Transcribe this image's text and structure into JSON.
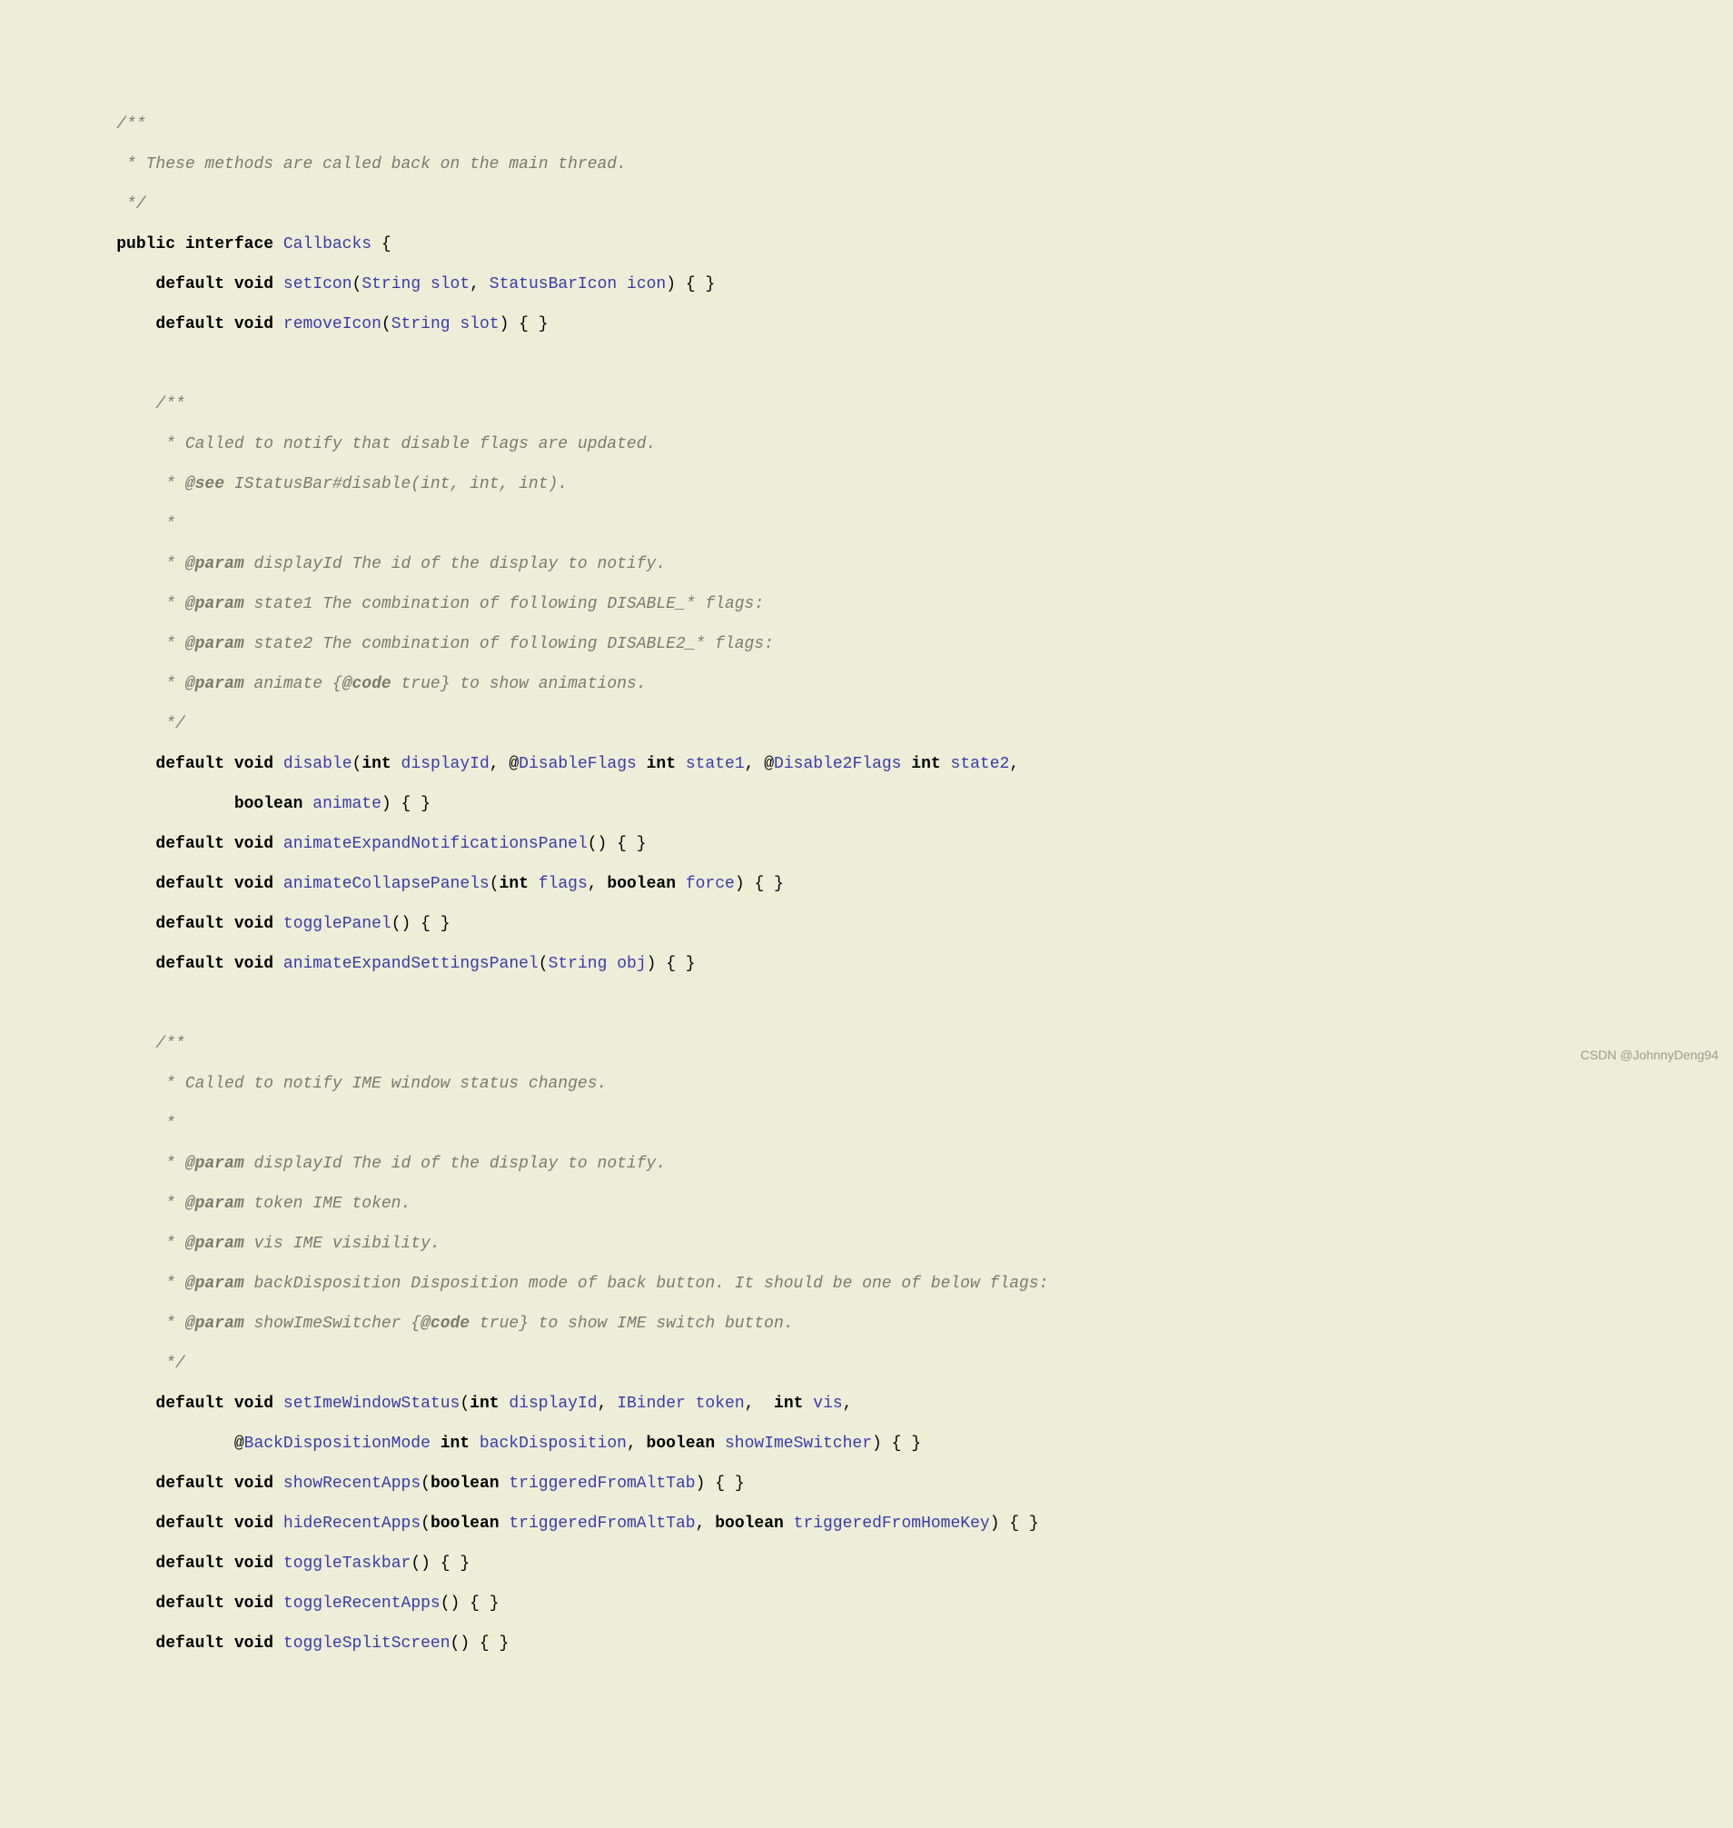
{
  "code": {
    "l1": "    /**",
    "l2_a": "     * ",
    "l2_b": "These methods are called back on the main thread.",
    "l3": "     */",
    "l4_kw1": "public",
    "l4_kw2": "interface",
    "l4_name": "Callbacks",
    "l4_open": " {",
    "l5_kw1": "default",
    "l5_kw2": "void",
    "l5_m": "setIcon",
    "l5_t1": "String",
    "l5_p1": "slot",
    "l5_t2": "StatusBarIcon",
    "l5_p2": "icon",
    "l5_end": ") { }",
    "l6_kw1": "default",
    "l6_kw2": "void",
    "l6_m": "removeIcon",
    "l6_t1": "String",
    "l6_p1": "slot",
    "l6_end": ") { }",
    "l8": "        /**",
    "l9_a": "         * ",
    "l9_b": "Called to notify that disable flags are updated.",
    "l10_a": "         * ",
    "l10_b": "@see",
    "l10_c": " IStatusBar#disable(int, int, int).",
    "l11": "         *",
    "l12_a": "         * ",
    "l12_b": "@param",
    "l12_c": "displayId",
    "l12_d": " The id of the display to notify.",
    "l13_a": "         * ",
    "l13_b": "@param",
    "l13_c": "state1",
    "l13_d": " The combination of following DISABLE_* flags:",
    "l14_a": "         * ",
    "l14_b": "@param",
    "l14_c": "state2",
    "l14_d": " The combination of following DISABLE2_* flags:",
    "l15_a": "         * ",
    "l15_b": "@param",
    "l15_c": "animate",
    "l15_d": " {",
    "l15_e": "@code",
    "l15_f": " true} to show animations.",
    "l16": "         */",
    "l17_kw1": "default",
    "l17_kw2": "void",
    "l17_m": "disable",
    "l17_kw3": "int",
    "l17_p1": "displayId",
    "l17_s1": ", @",
    "l17_t1": "DisableFlags",
    "l17_kw4": "int",
    "l17_p2": "state1",
    "l17_s2": ", @",
    "l17_t2": "Disable2Flags",
    "l17_kw5": "int",
    "l17_p3": "state2",
    "l17_end": ",",
    "l18_kw1": "boolean",
    "l18_p1": "animate",
    "l18_end": ") { }",
    "l19_kw1": "default",
    "l19_kw2": "void",
    "l19_m": "animateExpandNotificationsPanel",
    "l19_end": "() { }",
    "l20_kw1": "default",
    "l20_kw2": "void",
    "l20_m": "animateCollapsePanels",
    "l20_kw3": "int",
    "l20_p1": "flags",
    "l20_kw4": "boolean",
    "l20_p2": "force",
    "l20_end": ") { }",
    "l21_kw1": "default",
    "l21_kw2": "void",
    "l21_m": "togglePanel",
    "l21_end": "() { }",
    "l22_kw1": "default",
    "l22_kw2": "void",
    "l22_m": "animateExpandSettingsPanel",
    "l22_t1": "String",
    "l22_p1": "obj",
    "l22_end": ") { }",
    "l24": "        /**",
    "l25_a": "         * ",
    "l25_b": "Called to notify IME window status changes.",
    "l26": "         *",
    "l27_a": "         * ",
    "l27_b": "@param",
    "l27_c": "displayId",
    "l27_d": " The id of the display to notify.",
    "l28_a": "         * ",
    "l28_b": "@param",
    "l28_c": "token",
    "l28_d": " IME token.",
    "l29_a": "         * ",
    "l29_b": "@param",
    "l29_c": "vis",
    "l29_d": " IME visibility.",
    "l30_a": "         * ",
    "l30_b": "@param",
    "l30_c": "backDisposition",
    "l30_d": " Disposition mode of back button. It should be one of below flags:",
    "l31_a": "         * ",
    "l31_b": "@param",
    "l31_c": "showImeSwitcher",
    "l31_d": " {",
    "l31_e": "@code",
    "l31_f": " true} to show IME switch button.",
    "l32": "         */",
    "l33_kw1": "default",
    "l33_kw2": "void",
    "l33_m": "setImeWindowStatus",
    "l33_kw3": "int",
    "l33_p1": "displayId",
    "l33_t1": "IBinder",
    "l33_p2": "token",
    "l33_kw4": "int",
    "l33_p3": "vis",
    "l33_end": ",",
    "l34_s1": "                @",
    "l34_t1": "BackDispositionMode",
    "l34_kw1": "int",
    "l34_p1": "backDisposition",
    "l34_kw2": "boolean",
    "l34_p2": "showImeSwitcher",
    "l34_end": ") { }",
    "l35_kw1": "default",
    "l35_kw2": "void",
    "l35_m": "showRecentApps",
    "l35_kw3": "boolean",
    "l35_p1": "triggeredFromAltTab",
    "l35_end": ") { }",
    "l36_kw1": "default",
    "l36_kw2": "void",
    "l36_m": "hideRecentApps",
    "l36_kw3": "boolean",
    "l36_p1": "triggeredFromAltTab",
    "l36_kw4": "boolean",
    "l36_p2": "triggeredFromHomeKey",
    "l36_end": ") { }",
    "l37_kw1": "default",
    "l37_kw2": "void",
    "l37_m": "toggleTaskbar",
    "l37_end": "() { }",
    "l38_kw1": "default",
    "l38_kw2": "void",
    "l38_m": "toggleRecentApps",
    "l38_end": "() { }",
    "l39_kw1": "default",
    "l39_kw2": "void",
    "l39_m": "toggleSplitScreen",
    "l39_end": "() { }"
  },
  "watermark": "CSDN @JohnnyDeng94"
}
